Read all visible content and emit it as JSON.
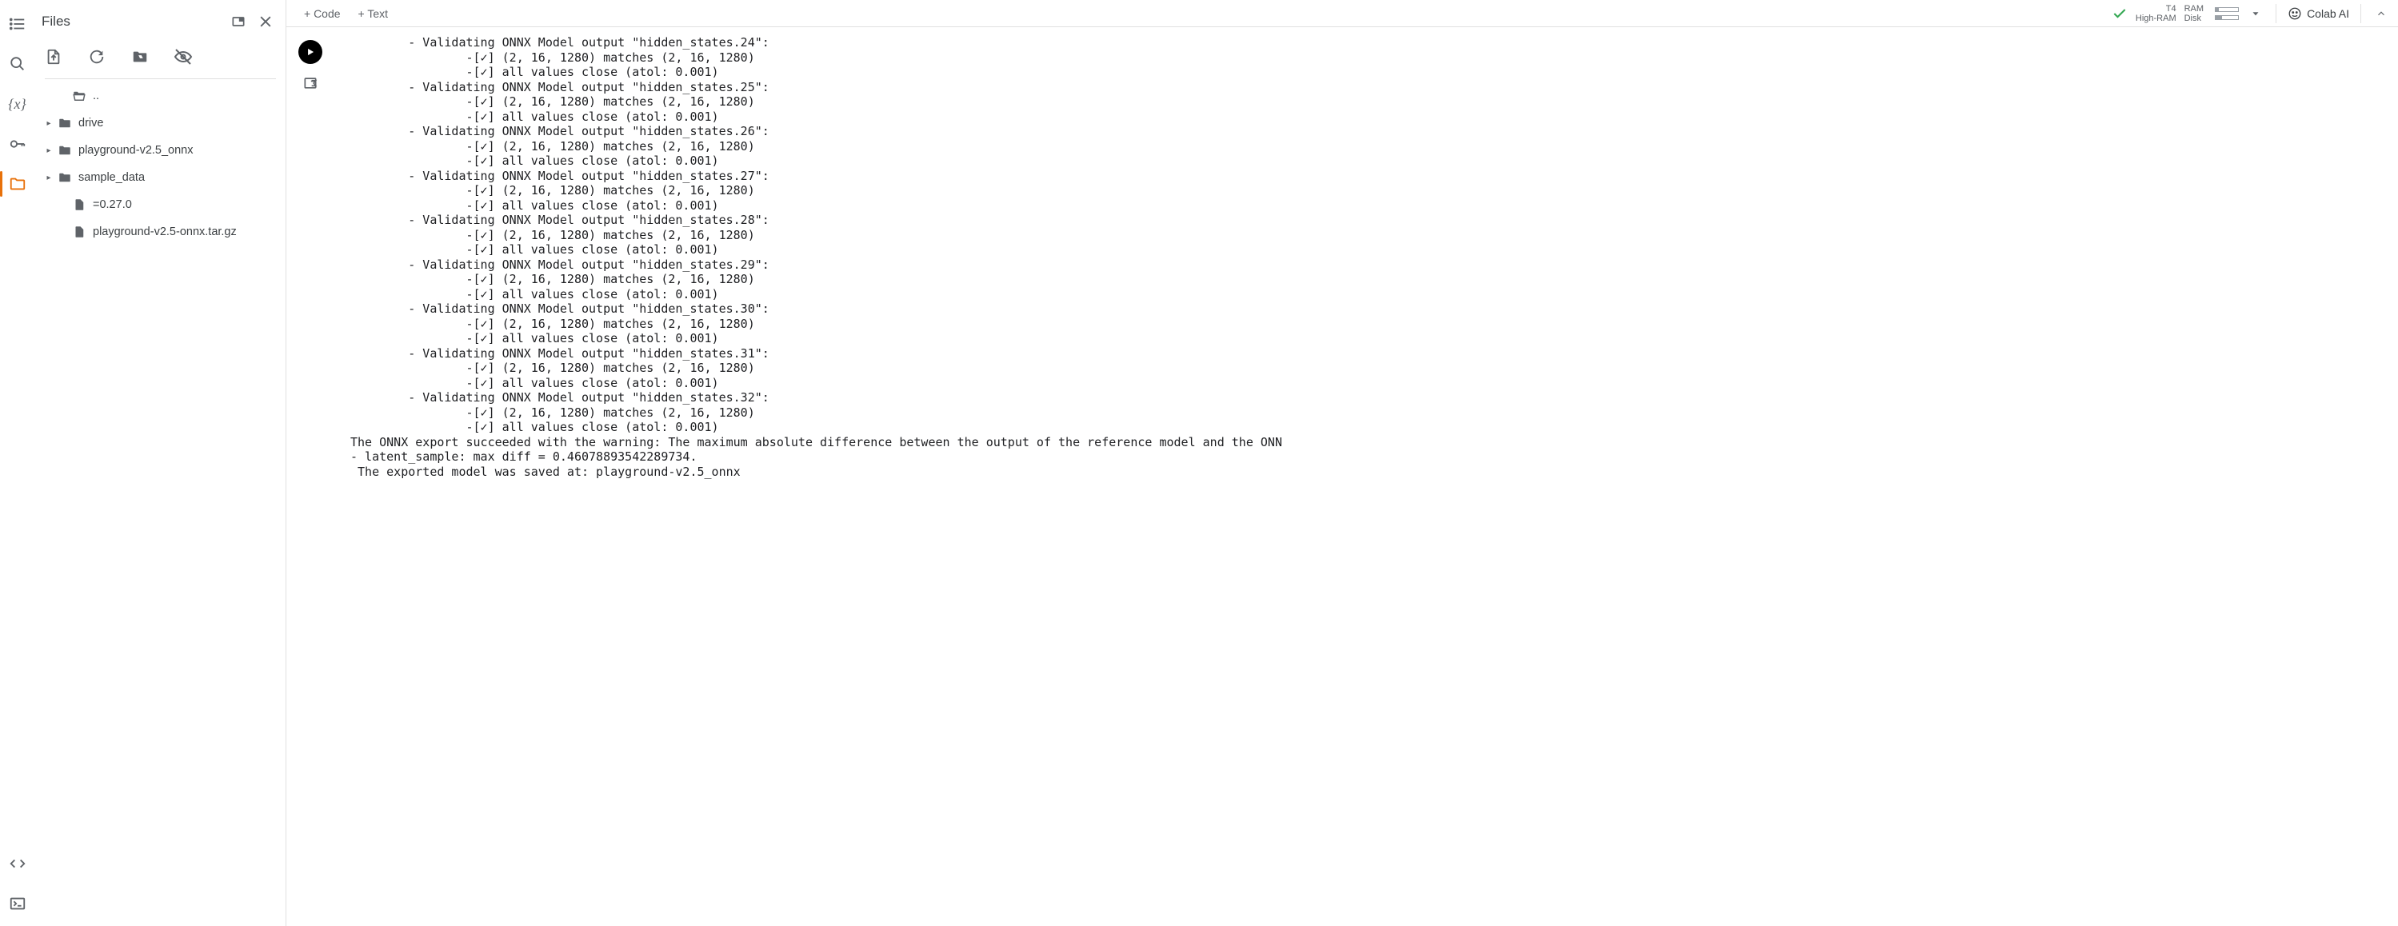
{
  "sidebar": {
    "title": "Files",
    "icons": {
      "toc": "toc-icon",
      "search": "search-icon",
      "vars": "variables-icon",
      "secrets": "key-icon",
      "files": "folder-icon",
      "code": "code-icon",
      "terminal": "terminal-icon"
    },
    "header_buttons": {
      "newwin": "open-in-new-icon",
      "close": "close-icon"
    },
    "toolbar": {
      "upload": "upload-file-icon",
      "refresh": "refresh-icon",
      "mount": "mount-drive-icon",
      "hide": "visibility-off-icon"
    },
    "tree": [
      {
        "kind": "folder-open",
        "label": "..",
        "arrow": ""
      },
      {
        "kind": "folder",
        "label": "drive",
        "arrow": "▸"
      },
      {
        "kind": "folder",
        "label": "playground-v2.5_onnx",
        "arrow": "▸"
      },
      {
        "kind": "folder",
        "label": "sample_data",
        "arrow": "▸"
      },
      {
        "kind": "file",
        "label": "=0.27.0",
        "arrow": ""
      },
      {
        "kind": "file",
        "label": "playground-v2.5-onnx.tar.gz",
        "arrow": ""
      }
    ]
  },
  "topbar": {
    "code": "+ Code",
    "text": "+ Text",
    "statusT4": "T4",
    "statusHR": "High-RAM",
    "ram_label": "RAM",
    "disk_label": "Disk",
    "ram_fill_pct": 15,
    "disk_fill_pct": 30,
    "colab_ai": "Colab AI"
  },
  "output": {
    "blocks": [
      {
        "label": "hidden_states.24",
        "shape": "(2, 16, 1280) matches (2, 16, 1280)",
        "atol": "0.001"
      },
      {
        "label": "hidden_states.25",
        "shape": "(2, 16, 1280) matches (2, 16, 1280)",
        "atol": "0.001"
      },
      {
        "label": "hidden_states.26",
        "shape": "(2, 16, 1280) matches (2, 16, 1280)",
        "atol": "0.001"
      },
      {
        "label": "hidden_states.27",
        "shape": "(2, 16, 1280) matches (2, 16, 1280)",
        "atol": "0.001"
      },
      {
        "label": "hidden_states.28",
        "shape": "(2, 16, 1280) matches (2, 16, 1280)",
        "atol": "0.001"
      },
      {
        "label": "hidden_states.29",
        "shape": "(2, 16, 1280) matches (2, 16, 1280)",
        "atol": "0.001"
      },
      {
        "label": "hidden_states.30",
        "shape": "(2, 16, 1280) matches (2, 16, 1280)",
        "atol": "0.001"
      },
      {
        "label": "hidden_states.31",
        "shape": "(2, 16, 1280) matches (2, 16, 1280)",
        "atol": "0.001"
      },
      {
        "label": "hidden_states.32",
        "shape": "(2, 16, 1280) matches (2, 16, 1280)",
        "atol": "0.001"
      }
    ],
    "trailer": [
      "The ONNX export succeeded with the warning: The maximum absolute difference between the output of the reference model and the ONN",
      "- latent_sample: max diff = 0.46078893542289734.",
      " The exported model was saved at: playground-v2.5_onnx"
    ]
  }
}
